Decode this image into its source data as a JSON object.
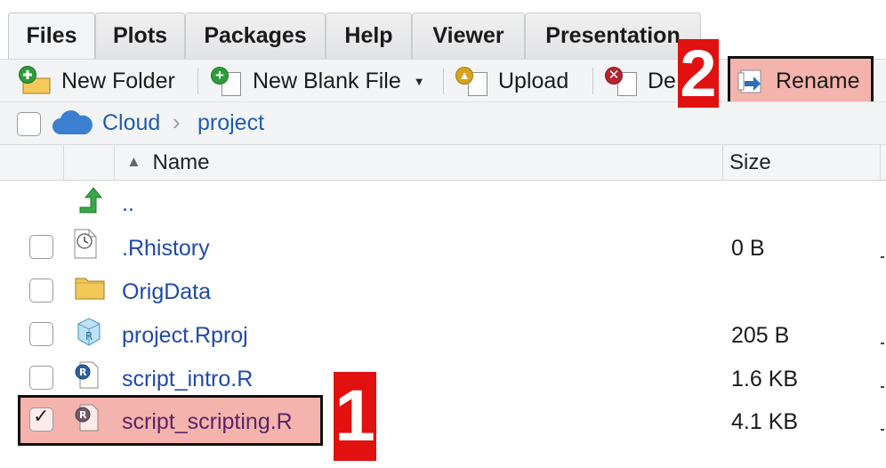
{
  "tabs": [
    {
      "label": "Files",
      "active": true
    },
    {
      "label": "Plots"
    },
    {
      "label": "Packages"
    },
    {
      "label": "Help"
    },
    {
      "label": "Viewer"
    },
    {
      "label": "Presentation"
    }
  ],
  "toolbar": {
    "new_folder": "New Folder",
    "new_blank_file": "New Blank File",
    "upload": "Upload",
    "delete": "De",
    "rename": "Rename"
  },
  "breadcrumb": {
    "root": "Cloud",
    "separator": "›",
    "current": "project"
  },
  "columns": {
    "name": "Name",
    "size": "Size",
    "sort_indicator": "▲"
  },
  "files": [
    {
      "name": "..",
      "size": "",
      "type": "parent-dir",
      "checked": false
    },
    {
      "name": ".Rhistory",
      "size": "0 B",
      "type": "history",
      "checked": false
    },
    {
      "name": "OrigData",
      "size": "",
      "type": "folder",
      "checked": false
    },
    {
      "name": "project.Rproj",
      "size": "205 B",
      "type": "rproj",
      "checked": false
    },
    {
      "name": "script_intro.R",
      "size": "1.6 KB",
      "type": "r-script",
      "checked": false
    },
    {
      "name": "script_scripting.R",
      "size": "4.1 KB",
      "type": "r-script",
      "checked": true
    }
  ],
  "callouts": {
    "step1": "1",
    "step2": "2"
  },
  "colors": {
    "highlight": "#f4b4ad",
    "callout_red": "#e0110f",
    "link_blue": "#1f4aa8",
    "selected_text": "#5a2466"
  }
}
